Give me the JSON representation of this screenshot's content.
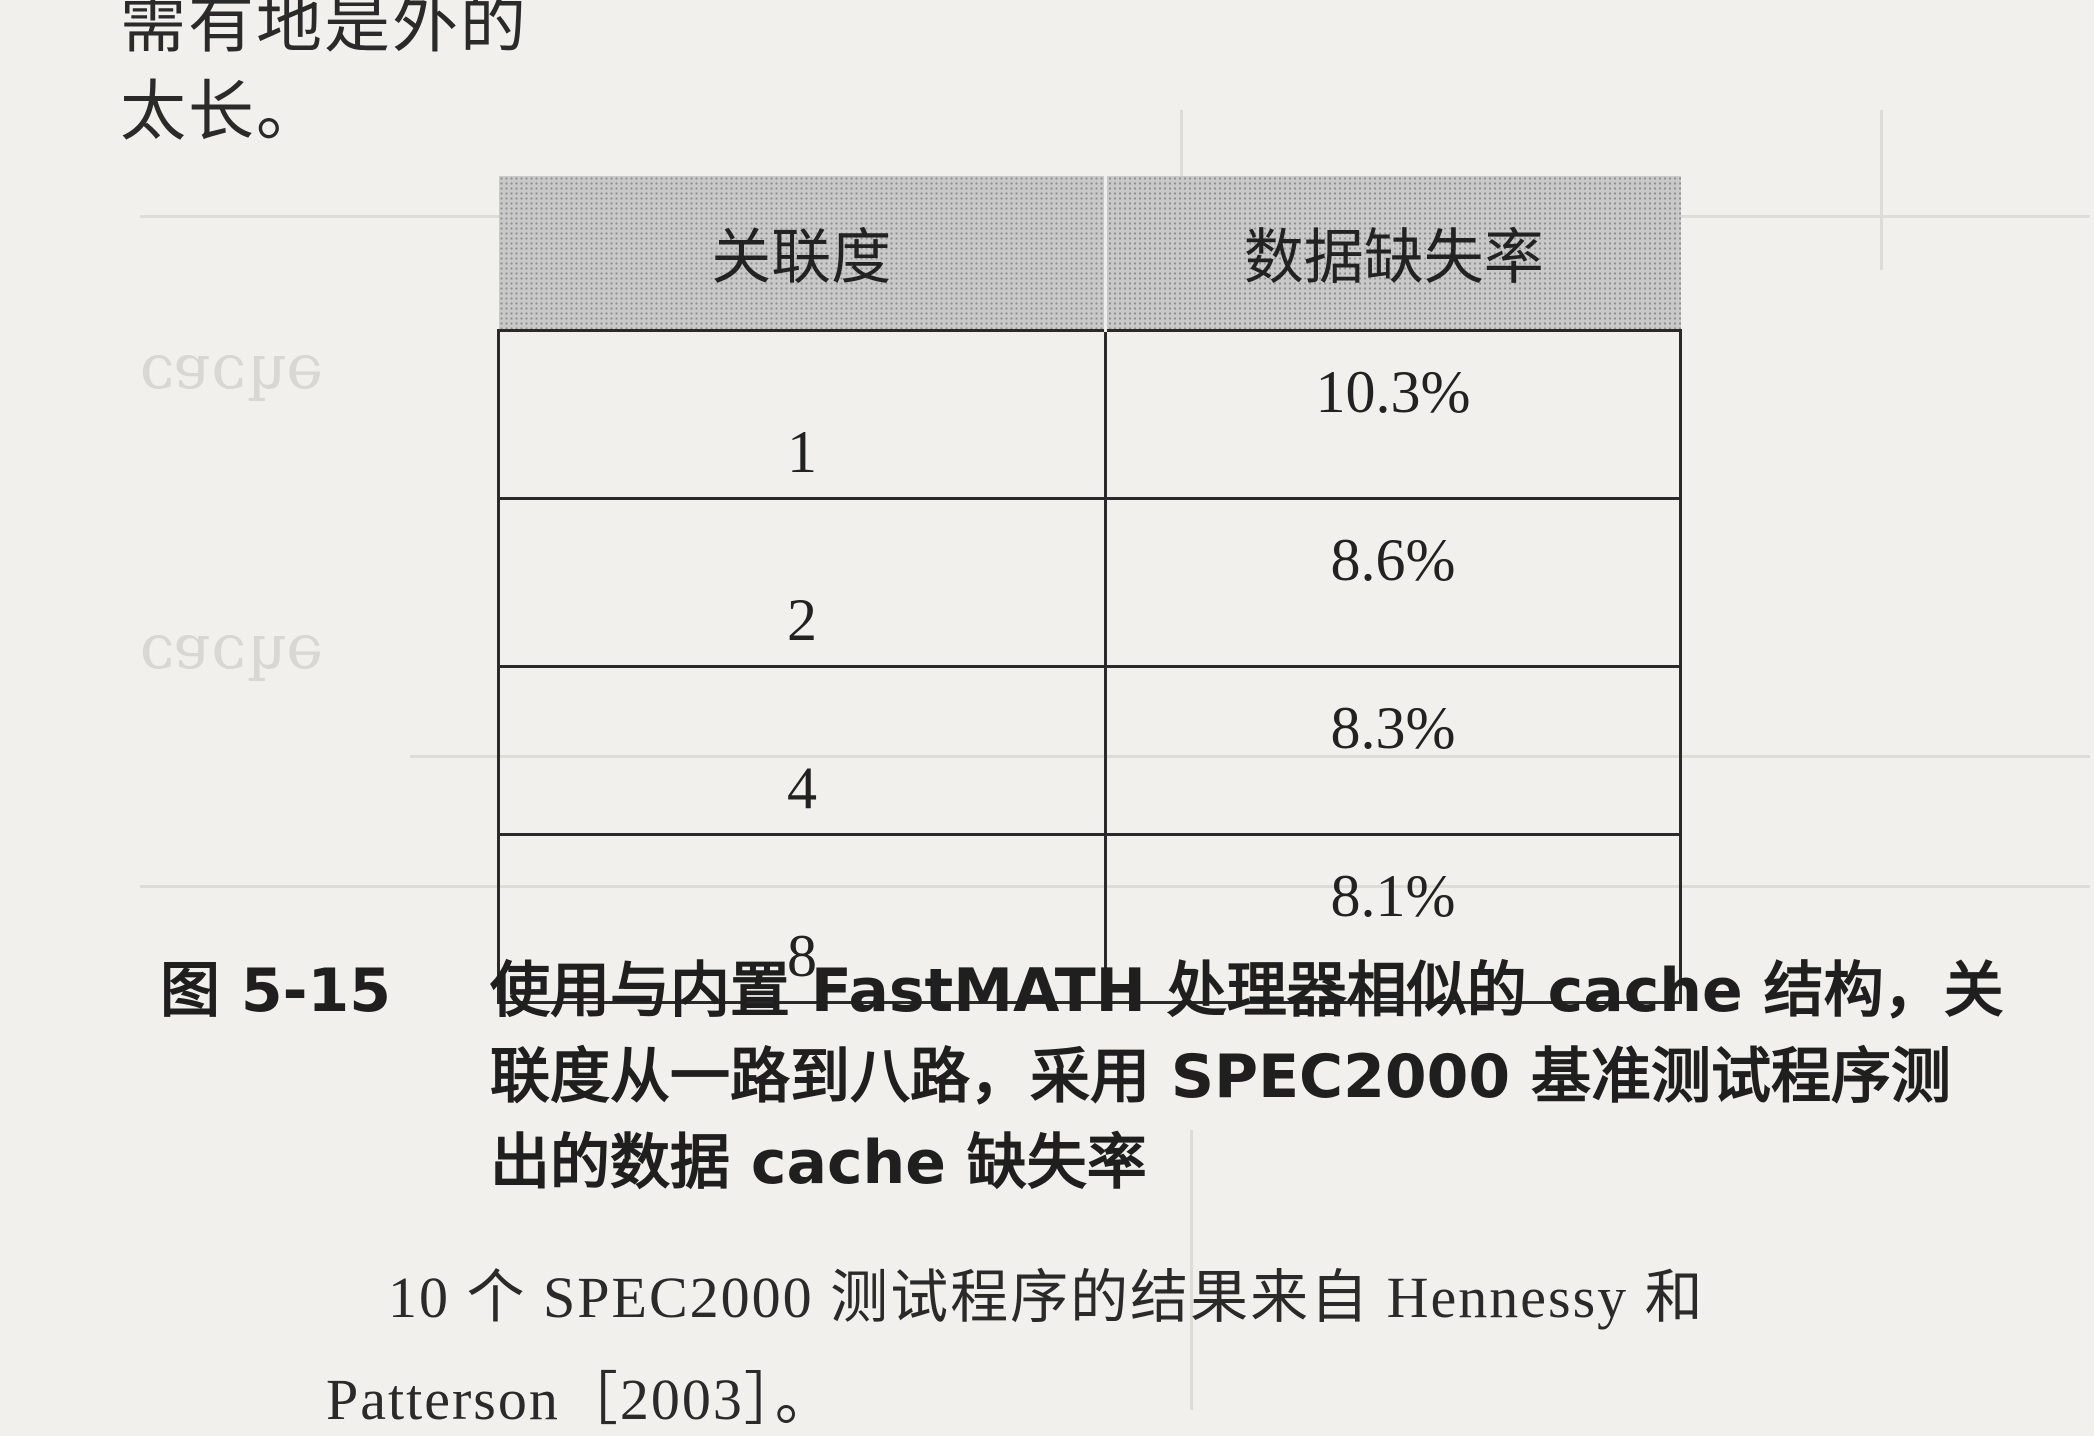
{
  "page": {
    "top_line_partial": "需有地是外的",
    "top_line_end": "太长。"
  },
  "table": {
    "headers": [
      "关联度",
      "数据缺失率"
    ],
    "rows": [
      {
        "associativity": "1",
        "miss_rate": "10.3%"
      },
      {
        "associativity": "2",
        "miss_rate": "8.6%"
      },
      {
        "associativity": "4",
        "miss_rate": "8.3%"
      },
      {
        "associativity": "8",
        "miss_rate": "8.1%"
      }
    ]
  },
  "caption": {
    "number": "图 5-15",
    "text": "使用与内置 FastMATH 处理器相似的 cache 结构，关联度从一路到八路，采用 SPEC2000 基准测试程序测出的数据 cache 缺失率"
  },
  "note": {
    "line1": "10 个 SPEC2000 测试程序的结果来自 Hennessy 和",
    "line2": "Patterson［2003］。"
  },
  "colors": {
    "paper": "#f1f0ec",
    "text": "#222222",
    "header_shading": "#c9c9c9"
  }
}
